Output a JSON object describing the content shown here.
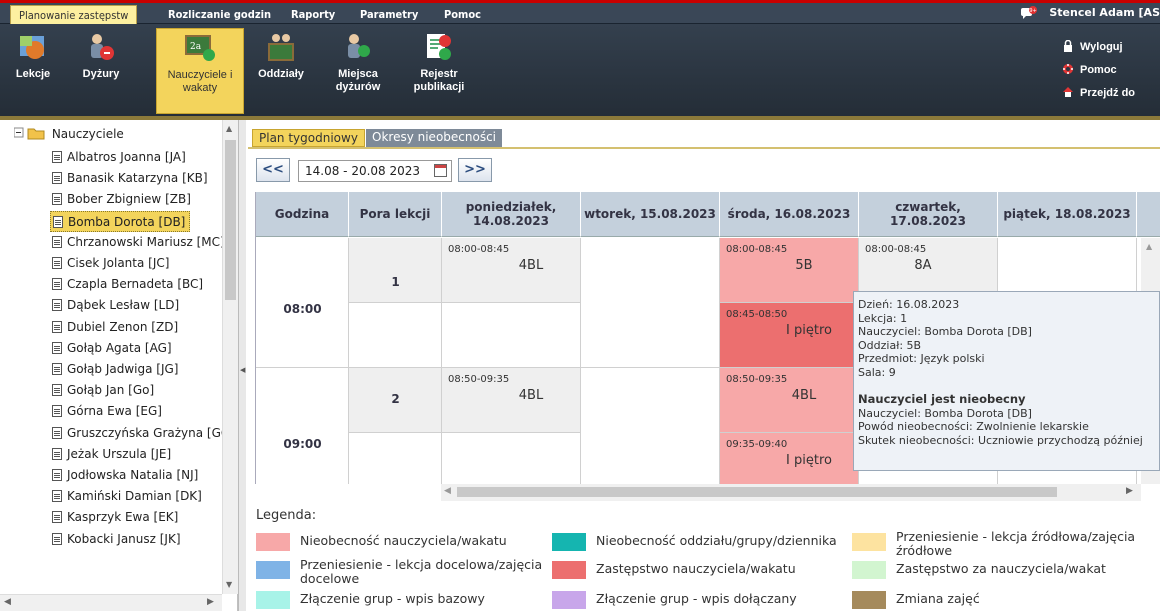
{
  "menu": {
    "items": [
      "Planowanie zastępstw",
      "Rozliczanie godzin",
      "Raporty",
      "Parametry",
      "Pomoc"
    ],
    "notification_badge": "9+",
    "user": "Stencel Adam [AS"
  },
  "ribbon": {
    "buttons": [
      "Lekcje",
      "Dyżury",
      "Nauczyciele i wakaty",
      "Oddziały",
      "Miejsca dyżurów",
      "Rejestr publikacji"
    ],
    "links": [
      "Wyloguj",
      "Pomoc",
      "Przejdź do"
    ]
  },
  "tree": {
    "root": "Nauczyciele",
    "items": [
      "Albatros Joanna [JA]",
      "Banasik Katarzyna [KB]",
      "Bober Zbigniew [ZB]",
      "Bomba Dorota [DB]",
      "Chrzanowski Mariusz [MC]",
      "Cisek Jolanta [JC]",
      "Czapla Bernadeta [BC]",
      "Dąbek Lesław [LD]",
      "Dubiel Zenon [ZD]",
      "Gołąb Agata [AG]",
      "Gołąb Jadwiga [JG]",
      "Gołąb Jan [Go]",
      "Górna Ewa [EG]",
      "Gruszczyńska Grażyna [GG",
      "Jeżak Urszula [JE]",
      "Jodłowska Natalia [NJ]",
      "Kamiński Damian [DK]",
      "Kasprzyk Ewa [EK]",
      "Kobacki Janusz [JK]"
    ],
    "selected_index": 3
  },
  "tabs": [
    "Plan tygodniowy",
    "Okresy nieobecności"
  ],
  "nav": {
    "prev": "<<",
    "next": ">>",
    "date_range": "14.08 - 20.08 2023"
  },
  "table": {
    "headers": [
      "Godzina",
      "Pora lekcji",
      "poniedziałek, 14.08.2023",
      "wtorek, 15.08.2023",
      "środa, 16.08.2023",
      "czwartek, 17.08.2023",
      "piątek, 18.08.2023"
    ],
    "hours": [
      "08:00",
      "09:00"
    ],
    "lessons": [
      "1",
      "2"
    ],
    "cells": {
      "mon_1": {
        "time": "08:00-08:45",
        "name": "4BL"
      },
      "mon_2": {
        "time": "08:50-09:35",
        "name": "4BL"
      },
      "wed_1": {
        "time": "08:00-08:45",
        "name": "5B"
      },
      "wed_d1": {
        "time": "08:45-08:50",
        "name": "I piętro"
      },
      "wed_2": {
        "time": "08:50-09:35",
        "name": "4BL"
      },
      "wed_d2": {
        "time": "09:35-09:40",
        "name": "I piętro"
      },
      "thu_1": {
        "time": "08:00-08:45",
        "name": "8A"
      }
    }
  },
  "tooltip": {
    "lines": [
      "Dzień: 16.08.2023",
      "Lekcja: 1",
      "Nauczyciel: Bomba Dorota [DB]",
      "Oddział: 5B",
      "Przedmiot: Język polski",
      "Sala: 9"
    ],
    "bold": "Nauczyciel jest nieobecny",
    "lines2": [
      "Nauczyciel: Bomba Dorota [DB]",
      "Powód nieobecności: Zwolnienie lekarskie",
      "Skutek nieobecności: Uczniowie przychodzą później"
    ]
  },
  "legend": {
    "title": "Legenda:",
    "items": [
      {
        "label": "Nieobecność nauczyciela/wakatu",
        "color": "#f7a8a8"
      },
      {
        "label": "Nieobecność oddziału/grupy/dziennika",
        "color": "#15b5b0"
      },
      {
        "label": "Przeniesienie - lekcja źródłowa/zajęcia źródłowe",
        "color": "#fde3a0"
      },
      {
        "label": "Przeniesienie - lekcja docelowa/zajęcia docelowe",
        "color": "#7fb3e6"
      },
      {
        "label": "Zastępstwo nauczyciela/wakatu",
        "color": "#ec6f6f"
      },
      {
        "label": "Zastępstwo za nauczyciela/wakat",
        "color": "#d2f5d0"
      },
      {
        "label": "Złączenie grup - wpis bazowy",
        "color": "#a8f3e8"
      },
      {
        "label": "Złączenie grup - wpis dołączany",
        "color": "#c8a6ea"
      },
      {
        "label": "Zmiana zajęć",
        "color": "#a58a5c"
      }
    ]
  }
}
